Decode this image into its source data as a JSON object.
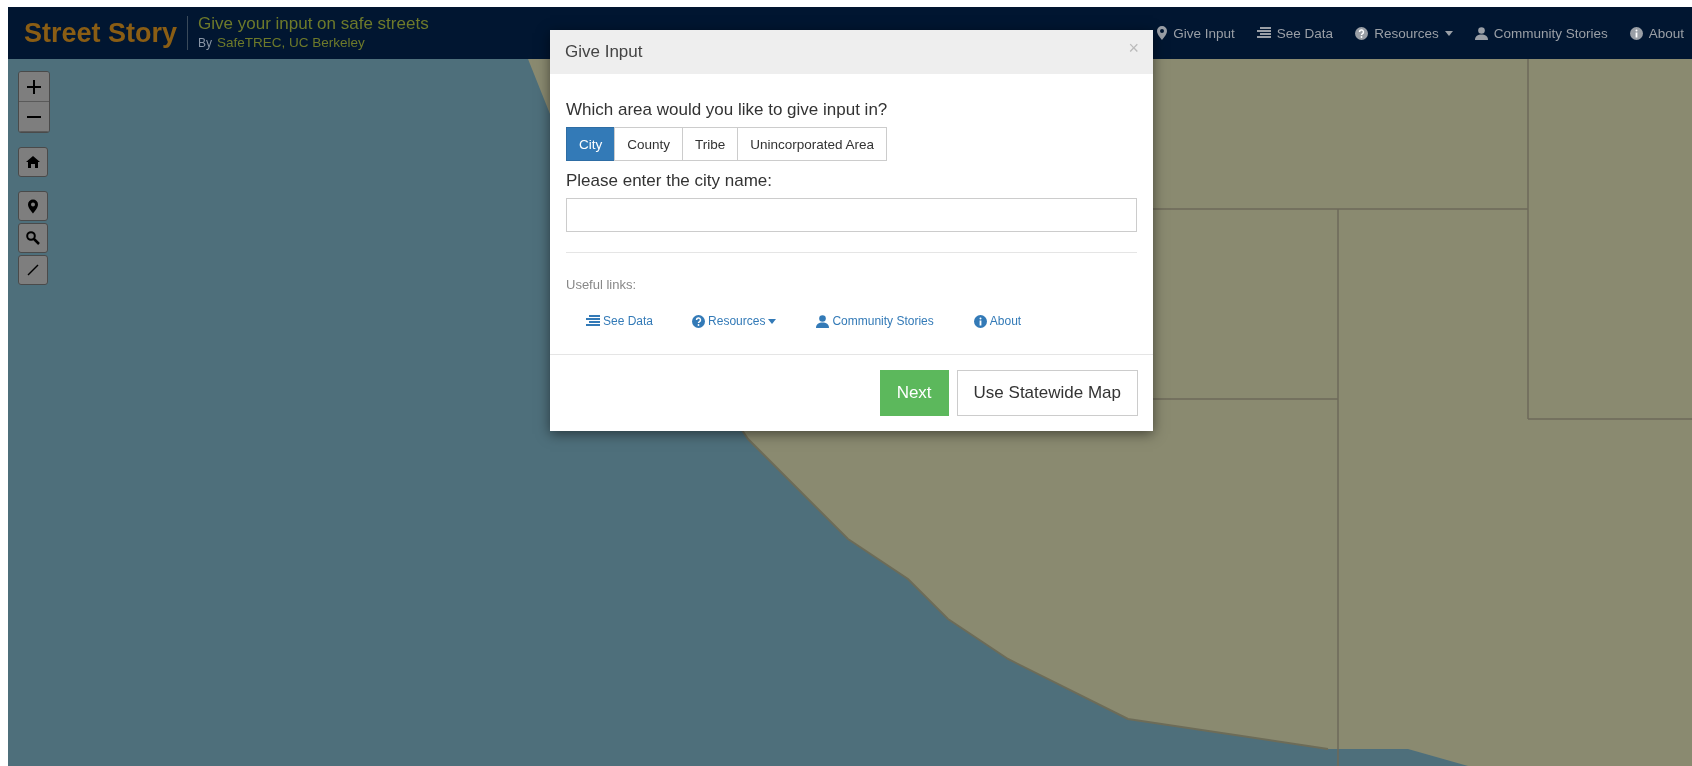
{
  "header": {
    "title": "Street Story",
    "tagline": "Give your input on safe streets",
    "byline_prefix": "By",
    "byline": "SafeTREC, UC Berkeley",
    "nav": [
      {
        "label": "Give Input",
        "dropdown": false
      },
      {
        "label": "See Data",
        "dropdown": false
      },
      {
        "label": "Resources",
        "dropdown": true
      },
      {
        "label": "Community Stories",
        "dropdown": false
      },
      {
        "label": "About",
        "dropdown": false
      }
    ]
  },
  "dialog": {
    "title": "Give Input",
    "close": "×",
    "question": "Which area would you like to give input in?",
    "area_options": [
      {
        "label": "City",
        "selected": true
      },
      {
        "label": "County",
        "selected": false
      },
      {
        "label": "Tribe",
        "selected": false
      },
      {
        "label": "Unincorporated Area",
        "selected": false
      }
    ],
    "field_label": "Please enter the city name:",
    "useful_links_label": "Useful links:",
    "links": [
      {
        "label": "See Data",
        "dropdown": false
      },
      {
        "label": "Resources",
        "dropdown": true
      },
      {
        "label": "Community Stories",
        "dropdown": false
      },
      {
        "label": "About",
        "dropdown": false
      }
    ],
    "buttons": [
      {
        "label": "Next",
        "kind": "primary"
      },
      {
        "label": "Use Statewide Map",
        "kind": "default"
      }
    ]
  }
}
